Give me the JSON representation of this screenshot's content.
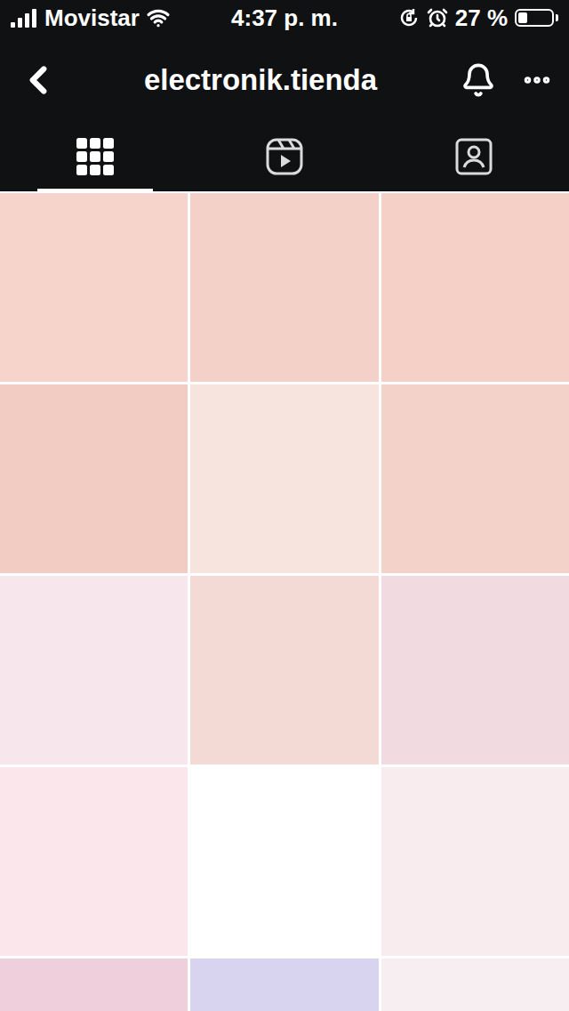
{
  "status_bar": {
    "carrier": "Movistar",
    "time": "4:37 p. m.",
    "battery_text": "27 %",
    "battery_level": 0.27
  },
  "header": {
    "title": "electronik.tienda"
  },
  "tabs": [
    {
      "kind": "grid",
      "selected": true
    },
    {
      "kind": "reels",
      "selected": false
    },
    {
      "kind": "tagged",
      "selected": false
    }
  ],
  "posts": [
    {
      "color": "#f6d3cb"
    },
    {
      "color": "#f3d0c8"
    },
    {
      "color": "#f5d0c6"
    },
    {
      "color": "#f2cbc2"
    },
    {
      "color": "#f7e4df"
    },
    {
      "color": "#f3d2ca"
    },
    {
      "color": "#f7e6ec"
    },
    {
      "color": "#f4dad4"
    },
    {
      "color": "#f1dbe1"
    },
    {
      "color": "#fbe6ec"
    },
    {
      "color": "#ffffff"
    },
    {
      "color": "#f8ecef"
    },
    {
      "color": "#f0cfdc"
    },
    {
      "color": "#d8d3ef"
    },
    {
      "color": "#f6eef0"
    }
  ]
}
